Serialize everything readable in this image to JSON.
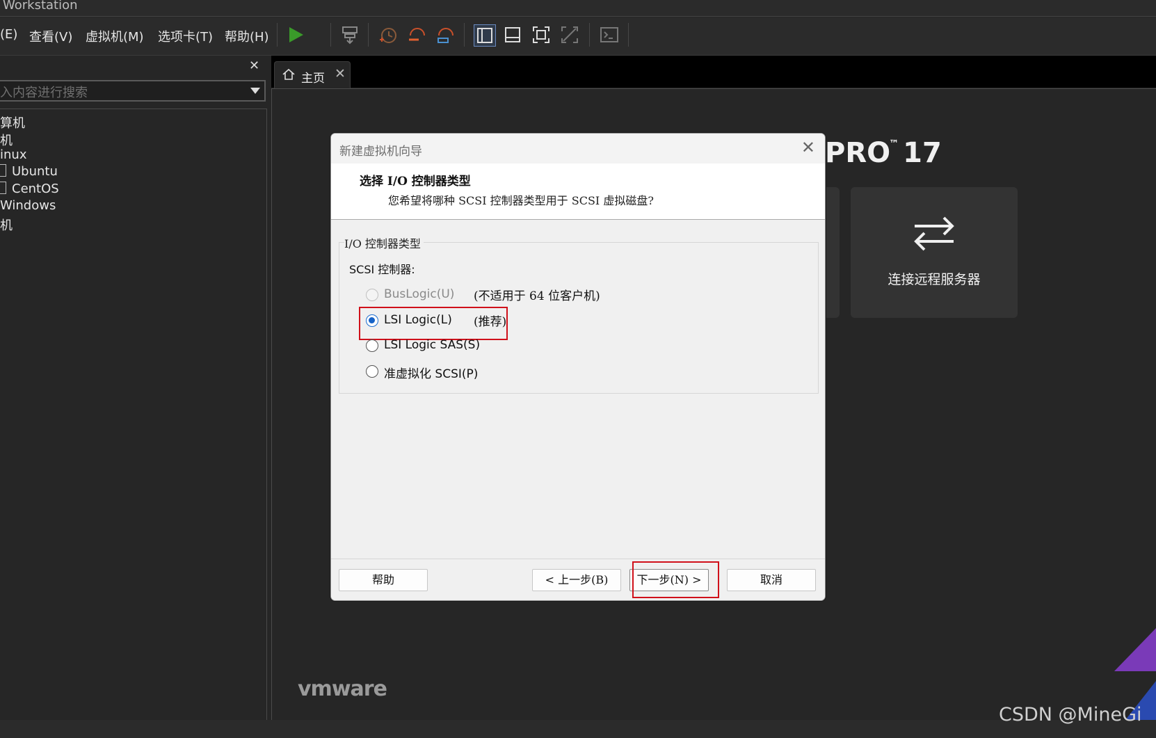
{
  "window": {
    "title": "Workstation"
  },
  "menu": [
    "(E)",
    "查看(V)",
    "虚拟机(M)",
    "选项卡(T)",
    "帮助(H)"
  ],
  "library": {
    "search_placeholder": "入内容进行搜索",
    "items": [
      "算机",
      "机",
      "inux",
      "Ubuntu",
      "CentOS",
      "Windows",
      "机"
    ]
  },
  "tab": {
    "label": "主页"
  },
  "home": {
    "product": "PRO",
    "version": "17",
    "tm": "™",
    "connect_remote": "连接远程服务器",
    "brand": "vmware"
  },
  "dialog": {
    "title": "新建虚拟机向导",
    "heading": "选择 I/O 控制器类型",
    "subheading": "您希望将哪种 SCSI 控制器类型用于 SCSI 虚拟磁盘?",
    "group_label": "I/O 控制器类型",
    "scsi_label": "SCSI 控制器:",
    "options": [
      {
        "label": "BusLogic(U)",
        "note": "(不适用于 64 位客户机)",
        "state": "disabled"
      },
      {
        "label": "LSI Logic(L)",
        "note": "(推荐)",
        "state": "selected"
      },
      {
        "label": "LSI Logic SAS(S)",
        "note": "",
        "state": "unselected"
      },
      {
        "label": "准虚拟化 SCSI(P)",
        "note": "",
        "state": "unselected"
      }
    ],
    "buttons": {
      "help": "帮助",
      "back": "< 上一步(B)",
      "next": "下一步(N) >",
      "cancel": "取消"
    }
  },
  "watermark": "CSDN @MineGi",
  "colors": {
    "highlight": "#d0101a",
    "radio_selected": "#1663c7",
    "play": "#3a9a2a"
  }
}
